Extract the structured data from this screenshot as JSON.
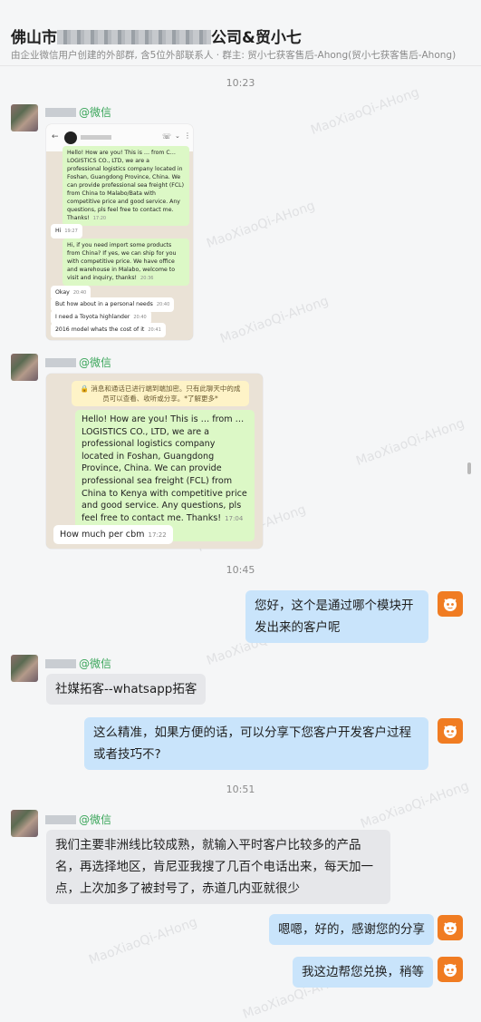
{
  "header": {
    "title_prefix": "佛山市",
    "title_suffix": "公司&贸小七",
    "subtitle": "由企业微信用户创建的外部群, 含5位外部联系人 · 群主: 贸小七获客售后-Ahong(贸小七获客售后-Ahong)"
  },
  "watermark": "MaoXiaoQi-AHong",
  "timestamps": [
    "10:23",
    "10:45",
    "10:51"
  ],
  "sender_tag": "@微信",
  "shot1": {
    "msg1": "Hello! How are you! This is … from C… LOGISTICS CO., LTD, we are a professional logistics company located in Foshan, Guangdong Province, China. We can provide professional sea freight (FCL) from China to Malabo/Bata with competitive price and good service. Any questions, pls feel free to contact me. Thanks!",
    "msg1_time": "17:20",
    "msg2": "Hi",
    "msg2_time": "19:27",
    "msg3": "Hi, if you need import some products from China? If yes, we can ship for you with competitive price. We have office and warehouse in Malabo, welcome to visit and inquiry, thanks!",
    "msg3_time": "20:36",
    "msg4": "Okay",
    "msg4_time": "20:40",
    "msg5": "But how about in a personal needs",
    "msg5_time": "20:40",
    "msg6": "I need a Toyota highlander",
    "msg6_time": "20:40",
    "msg7": "2016 model whats the cost of it",
    "msg7_time": "20:41"
  },
  "shot2": {
    "notice": "消息和通话已进行端到端加密。只有此聊天中的成员可以查看、收听或分享。*了解更多*",
    "msg1": "Hello! How are you! This is … from … LOGISTICS CO., LTD, we are a professional logistics company  located in Foshan, Guangdong Province, China. We can provide professional sea freight (FCL) from China to Kenya with competitive price and good service. Any questions, pls feel free to contact me. Thanks!",
    "msg1_time": "17:04",
    "msg2": "How much per cbm",
    "msg2_time": "17:22"
  },
  "messages": {
    "q1": "您好，这个是通过哪个模块开发出来的客户呢",
    "a1": "社媒拓客--whatsapp拓客",
    "q2": "这么精准，如果方便的话，可以分享下您客户开发客户过程或者技巧不?",
    "a2": "我们主要非洲线比较成熟，就输入平时客户比较多的产品名，再选择地区，肯尼亚我搜了几百个电话出来，每天加一点，上次加多了被封号了，赤道几内亚就很少",
    "q3": "嗯嗯，好的，感谢您的分享",
    "q4": "我这边帮您兑换，稍等"
  },
  "colors": {
    "right_bubble": "#c9e4fb",
    "left_bubble": "#e6e7ea",
    "wechat_green": "#3aa55a",
    "agent_avatar": "#f07c22"
  }
}
